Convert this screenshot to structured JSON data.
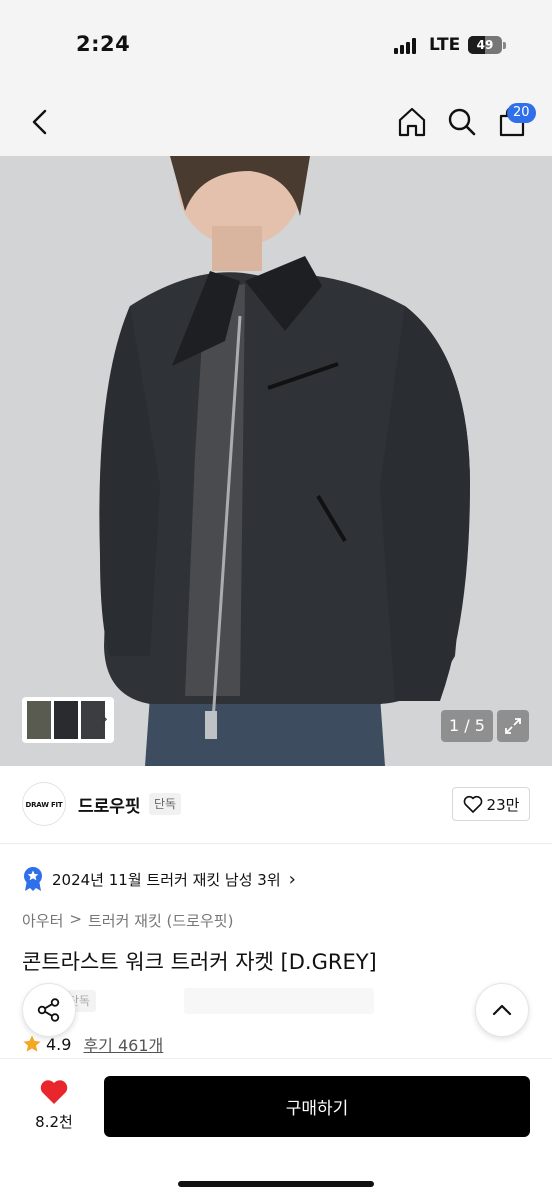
{
  "status_bar": {
    "time": "2:24",
    "network": "LTE",
    "battery_level": "49",
    "battery_fraction": 0.49
  },
  "nav": {
    "back_icon": "chevron-left-icon",
    "home_icon": "home-icon",
    "search_icon": "search-icon",
    "cart_icon": "shopping-bag-icon",
    "cart_count": "20",
    "badge_color": "#2f6fea"
  },
  "gallery": {
    "counter": "1 / 5",
    "current_page": 1,
    "total_pages": 5,
    "expand_icon": "expand-icon",
    "thumbnail_more_icon": "chevron-right-icon"
  },
  "brand": {
    "logo_text": "DRAW FIT",
    "name": "드로우핏",
    "tag": "단독",
    "like_icon": "heart-outline-icon",
    "like_count": "23만"
  },
  "ranking": {
    "icon": "medal-icon",
    "text": "2024년 11월 트러커 재킷 남성 3위",
    "accent_color": "#2f6fea"
  },
  "breadcrumb": {
    "level1": "아우터",
    "separator": ">",
    "level2": "트러커 재킷 (드로우핏)"
  },
  "product": {
    "title": "콘트라스트 워크 트러커 자켓 [D.GREY]",
    "faded_tag": "단독",
    "rating": "4.9",
    "review_label": "후기 461개",
    "star_color": "#f5a623"
  },
  "floating": {
    "share_icon": "share-icon",
    "scroll_top_icon": "chevron-up-icon"
  },
  "bottom_bar": {
    "heart_icon": "heart-filled-icon",
    "heart_color": "#e8262b",
    "like_count": "8.2천",
    "buy_label": "구매하기"
  }
}
